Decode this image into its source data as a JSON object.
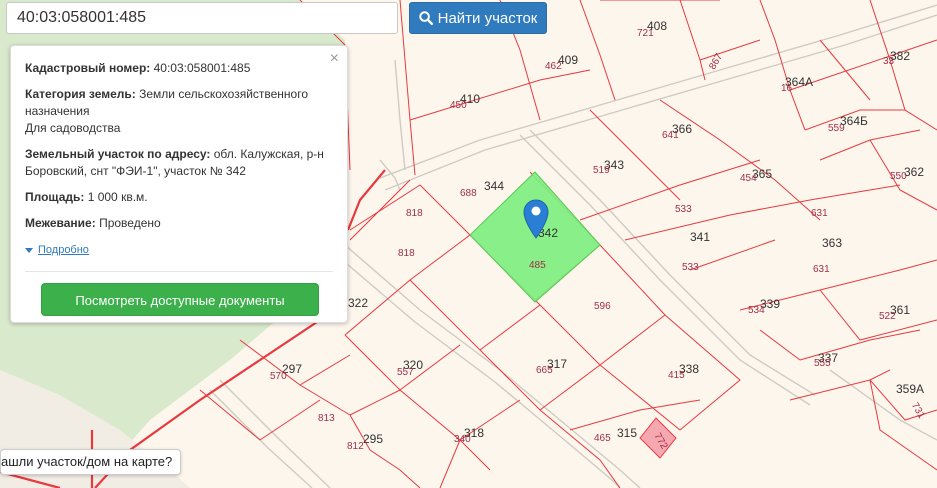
{
  "search": {
    "value": "40:03:058001:485",
    "button_label": "Найти участок"
  },
  "panel": {
    "cadastral_label": "Кадастровый номер:",
    "cadastral_value": "40:03:058001:485",
    "category_label": "Категория земель:",
    "category_value": "Земли сельскохозяйственного назначения",
    "usage_value": "Для садоводства",
    "address_label": "Земельный участок по адресу:",
    "address_value": "обл. Калужская, р-н Боровский, снт \"ФЭИ-1\", участок № 342",
    "area_label": "Площадь:",
    "area_value": "1 000 кв.м.",
    "survey_label": "Межевание:",
    "survey_value": "Проведено",
    "more_label": "Подробно",
    "docs_button": "Посмотреть доступные документы",
    "close_symbol": "×"
  },
  "help_button": "ашли участок/дом на карте?",
  "road_label": "867",
  "colors": {
    "boundary": "#e8393f",
    "selected_fill": "#7fee7f",
    "road": "#d9d6d0",
    "green_area": "#d6e8c8",
    "marker": "#2a7fd4",
    "area_text": "#a0304a"
  },
  "map_labels": [
    {
      "id": "408",
      "num": "408",
      "area": "721"
    },
    {
      "id": "409",
      "num": "409",
      "area": "462"
    },
    {
      "id": "410",
      "num": "410",
      "area": "450"
    },
    {
      "id": "382",
      "num": "382",
      "area": "33"
    },
    {
      "id": "364a",
      "num": "364А",
      "area": "16"
    },
    {
      "id": "364b",
      "num": "364Б",
      "area": "559"
    },
    {
      "id": "366",
      "num": "366",
      "area": "641"
    },
    {
      "id": "343",
      "num": "343",
      "area": "519"
    },
    {
      "id": "365",
      "num": "365",
      "area": "454"
    },
    {
      "id": "362",
      "num": "362",
      "area": "550"
    },
    {
      "id": "344",
      "num": "344",
      "area": "688"
    },
    {
      "id": "342",
      "num": "342",
      "area": "485"
    },
    {
      "id": "341",
      "num": "341",
      "area": "533"
    },
    {
      "id": "363",
      "num": "363",
      "area": "631"
    },
    {
      "id": "339",
      "num": "339",
      "area": "534"
    },
    {
      "id": "361",
      "num": "361",
      "area": "522"
    },
    {
      "id": "322",
      "num": "322",
      "area": ""
    },
    {
      "id": "297",
      "num": "297",
      "area": "570"
    },
    {
      "id": "320",
      "num": "320",
      "area": "557"
    },
    {
      "id": "317",
      "num": "317",
      "area": "665"
    },
    {
      "id": "338",
      "num": "338",
      "area": "415"
    },
    {
      "id": "337",
      "num": "337",
      "area": "555"
    },
    {
      "id": "359a",
      "num": "359А",
      "area": "731"
    },
    {
      "id": "295",
      "num": "295",
      "area": "812"
    },
    {
      "id": "318",
      "num": "318",
      "area": "340"
    },
    {
      "id": "315",
      "num": "315",
      "area": "465"
    }
  ],
  "extra_areas": [
    "818",
    "818",
    "533",
    "631",
    "596",
    "813",
    "772"
  ]
}
